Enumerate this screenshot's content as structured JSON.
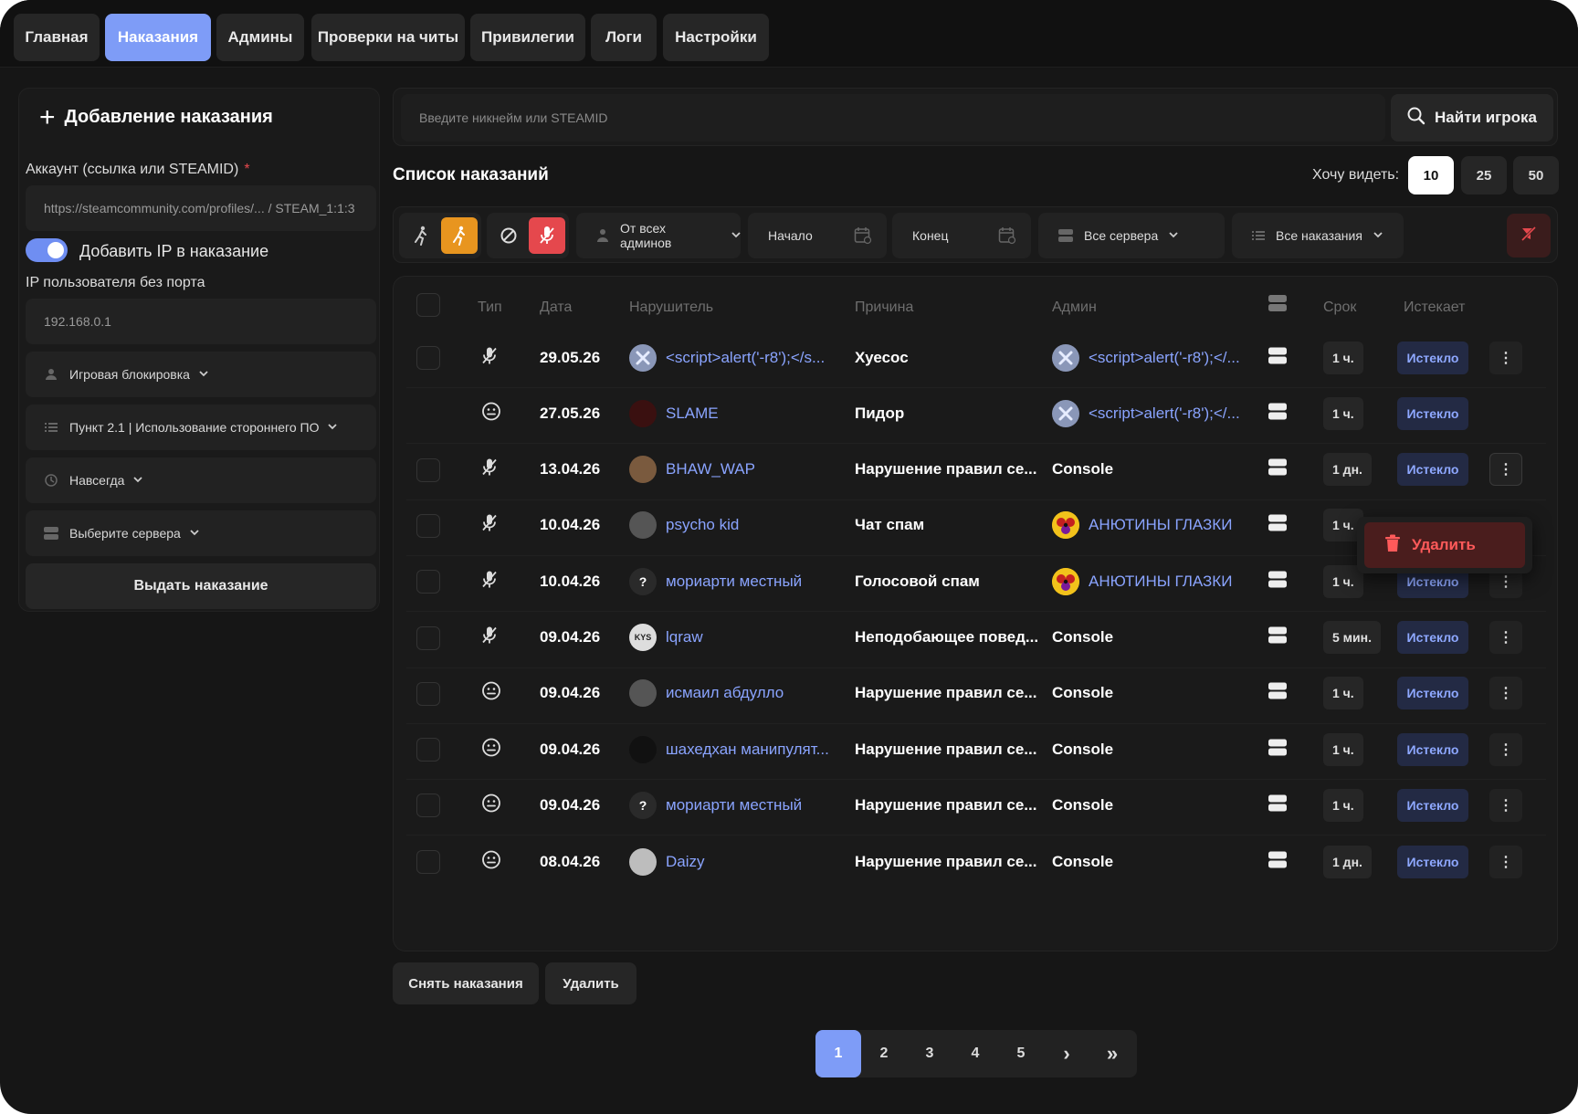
{
  "nav": {
    "tabs": [
      {
        "label": "Главная"
      },
      {
        "label": "Наказания",
        "active": true
      },
      {
        "label": "Админы"
      },
      {
        "label": "Проверки на читы"
      },
      {
        "label": "Привилегии"
      },
      {
        "label": "Логи"
      },
      {
        "label": "Настройки"
      }
    ]
  },
  "add_panel": {
    "title": "Добавление наказания",
    "account_label": "Аккаунт (ссылка или STEAMID)",
    "required_mark": "*",
    "account_placeholder": "https://steamcommunity.com/profiles/... / STEAM_1:1:3",
    "ip_toggle_label": "Добавить IP в наказание",
    "ip_toggle_on": true,
    "ip_label": "IP пользователя без порта",
    "ip_value": "192.168.0.1",
    "type_select": "Игровая блокировка",
    "reason_select": "Пункт 2.1 | Использование стороннего ПО",
    "duration_select": "Навсегда",
    "servers_select": "Выберите сервера",
    "submit_label": "Выдать наказание"
  },
  "search": {
    "placeholder": "Введите никнейм или STEAMID",
    "button_label": "Найти игрока"
  },
  "list": {
    "title": "Список наказаний",
    "per_page_label": "Хочу видеть:",
    "per_page_options": [
      "10",
      "25",
      "50"
    ],
    "per_page_selected": "10"
  },
  "filters": {
    "admins": "От всех админов",
    "start": "Начало",
    "end": "Конец",
    "servers": "Все сервера",
    "punishments": "Все наказания"
  },
  "table": {
    "headers": {
      "type": "Тип",
      "date": "Дата",
      "offender": "Нарушитель",
      "reason": "Причина",
      "admin": "Админ",
      "term": "Срок",
      "expires": "Истекает"
    },
    "rows": [
      {
        "type": "mic",
        "date": "29.05.26",
        "offender": "<script>alert('-r8');</s...",
        "offender_avatar": "x",
        "reason": "Хуесос",
        "admin": "<script>alert('-r8');</...",
        "admin_avatar": "x",
        "term": "1 ч.",
        "expires": "Истекло",
        "checkbox": true,
        "more": true
      },
      {
        "type": "chat",
        "date": "27.05.26",
        "offender": "SLAME",
        "offender_avatar": "red",
        "reason": "Пидор",
        "admin": "<script>alert('-r8');</...",
        "admin_avatar": "x",
        "term": "1 ч.",
        "expires": "Истекло",
        "checkbox": false,
        "more": false
      },
      {
        "type": "mic",
        "date": "13.04.26",
        "offender": "BHAW_WAP",
        "offender_avatar": "brown",
        "reason": "Нарушение правил се...",
        "admin": "Console",
        "admin_avatar": "",
        "term": "1 дн.",
        "expires": "Истекло",
        "checkbox": true,
        "more": true
      },
      {
        "type": "mic",
        "date": "10.04.26",
        "offender": "psycho kid",
        "offender_avatar": "grey",
        "reason": "Чат спам",
        "admin": "АНЮТИНЫ ГЛАЗКИ",
        "admin_avatar": "flower",
        "term": "1 ч.",
        "expires": "",
        "checkbox": true,
        "more": false
      },
      {
        "type": "mic",
        "date": "10.04.26",
        "offender": "мориарти местный",
        "offender_avatar": "q",
        "reason": "Голосовой спам",
        "admin": "АНЮТИНЫ ГЛАЗКИ",
        "admin_avatar": "flower",
        "term": "1 ч.",
        "expires": "Истекло",
        "checkbox": true,
        "more": true
      },
      {
        "type": "mic",
        "date": "09.04.26",
        "offender": "lqraw",
        "offender_avatar": "kys",
        "reason": "Неподобающее повед...",
        "admin": "Console",
        "admin_avatar": "",
        "term": "5 мин.",
        "expires": "Истекло",
        "checkbox": true,
        "more": true
      },
      {
        "type": "chat",
        "date": "09.04.26",
        "offender": "исмаил абдулло",
        "offender_avatar": "grey",
        "reason": "Нарушение правил се...",
        "admin": "Console",
        "admin_avatar": "",
        "term": "1 ч.",
        "expires": "Истекло",
        "checkbox": true,
        "more": true
      },
      {
        "type": "chat",
        "date": "09.04.26",
        "offender": "шахедхан манипулят...",
        "offender_avatar": "dark",
        "reason": "Нарушение правил се...",
        "admin": "Console",
        "admin_avatar": "",
        "term": "1 ч.",
        "expires": "Истекло",
        "checkbox": true,
        "more": true
      },
      {
        "type": "chat",
        "date": "09.04.26",
        "offender": "мориарти местный",
        "offender_avatar": "q",
        "reason": "Нарушение правил се...",
        "admin": "Console",
        "admin_avatar": "",
        "term": "1 ч.",
        "expires": "Истекло",
        "checkbox": true,
        "more": true
      },
      {
        "type": "chat",
        "date": "08.04.26",
        "offender": "Daizy",
        "offender_avatar": "light",
        "reason": "Нарушение правил се...",
        "admin": "Console",
        "admin_avatar": "",
        "term": "1 дн.",
        "expires": "Истекло",
        "checkbox": true,
        "more": true
      }
    ]
  },
  "context_menu": {
    "delete_label": "Удалить"
  },
  "actions": {
    "remove_label": "Снять наказания",
    "delete_label": "Удалить"
  },
  "pagination": {
    "pages": [
      "1",
      "2",
      "3",
      "4",
      "5"
    ],
    "current": "1",
    "next": "›",
    "last": "»"
  },
  "avatar_text": {
    "q": "?",
    "kys": "KYS"
  },
  "colors": {
    "accent": "#7e9cf7",
    "background": "#161616",
    "link": "#8aa4ff",
    "danger": "#e5484d",
    "orange": "#e8951f"
  }
}
